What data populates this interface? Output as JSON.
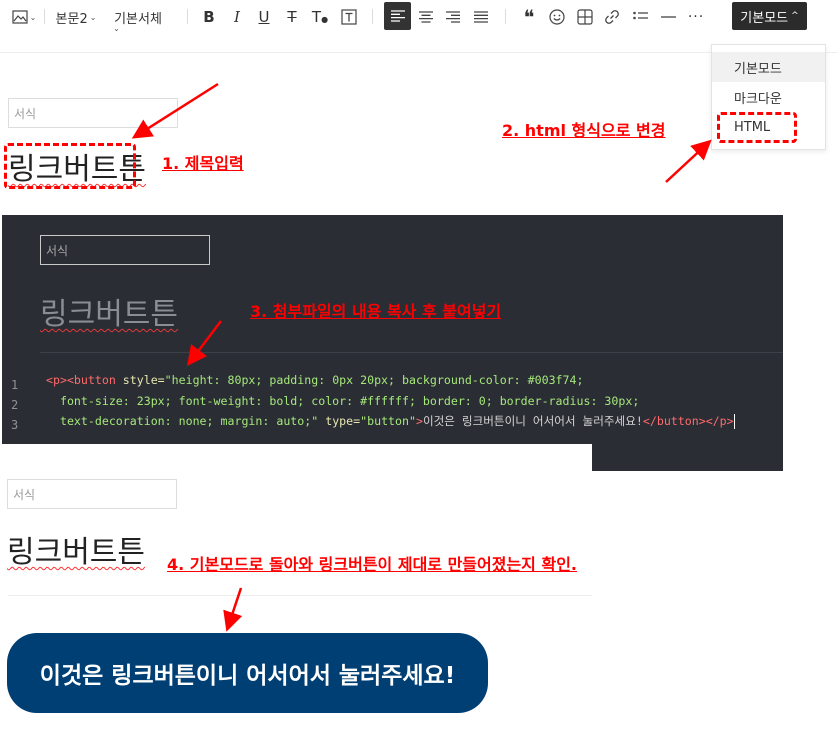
{
  "toolbar": {
    "paragraph_style": "본문2",
    "font_family": "기본서체",
    "mode_label": "기본모드"
  },
  "mode_dropdown": {
    "items": [
      "기본모드",
      "마크다운",
      "HTML"
    ]
  },
  "editor_basic": {
    "tag_placeholder": "서식",
    "title": "링크버트튼"
  },
  "editor_html": {
    "tag_placeholder": "서식",
    "title": "링크버트튼",
    "line_numbers": [
      "1",
      "2",
      "3"
    ],
    "code": {
      "line1_tag_open": "<p><button ",
      "line1_attr": "style=",
      "line1_value": "\"height: 80px; padding: 0px 20px; background-color: #003f74;",
      "line2_value": "  font-size: 23px; font-weight: bold; color: #ffffff; border: 0; border-radius: 30px;",
      "line3_value": "  text-decoration: none; margin: auto;\"",
      "line3_attr": " type=",
      "line3_type": "\"button\"",
      "line3_tag_gt": ">",
      "line3_text": "이것은 링크버튼이니 어서어서 눌러주세요!",
      "line3_tag_close": "</button></p>"
    }
  },
  "editor_result": {
    "tag_placeholder": "서식",
    "title": "링크버트튼",
    "button_label": "이것은 링크버튼이니 어서어서 눌러주세요!"
  },
  "annotations": {
    "step1": "1. 제목입력",
    "step2": "2. html 형식으로 변경",
    "step3": "3. 첨부파일의 내용 복사 후 붙여넣기",
    "step4": "4. 기본모드로 돌아와 링크버튼이 제대로 만들어졌는지 확인."
  },
  "colors": {
    "annotation": "#ff0000",
    "button_bg": "#003f74",
    "editor_dark_bg": "#2a2d34",
    "toolbar_active": "#333333"
  }
}
